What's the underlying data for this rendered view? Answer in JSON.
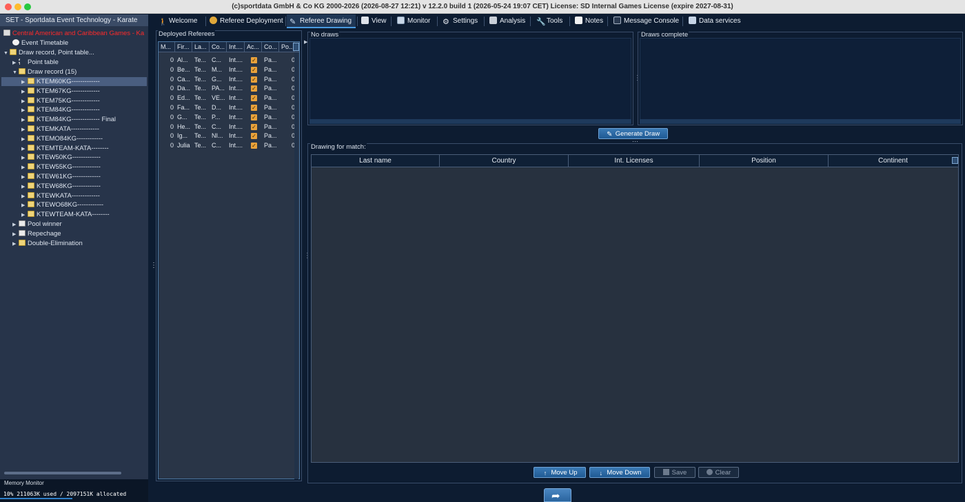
{
  "window": {
    "title": "(c)sportdata GmbH & Co KG 2000-2026 (2026-08-27 12:21)  v 12.2.0 build 1 (2026-05-24 19:07 CET) License: SD Internal Games License (expire 2027-08-31)"
  },
  "left_panel": {
    "header": "SET - Sportdata Event Technology - Karate",
    "tree": {
      "root": "Central American and Caribbean Games - Ka",
      "event_timetable": "Event Timetable",
      "draw_record_point_table": "Draw record, Point table...",
      "point_table": "Point table",
      "draw_record": "Draw record (15)",
      "draws": [
        "KTEM60KG-------------",
        "KTEM67KG-------------",
        "KTEM75KG-------------",
        "KTEM84KG-------------",
        "KTEM84KG------------- Final",
        "KTEMKATA-------------",
        "KTEMO84KG------------",
        "KTEMTEAM-KATA--------",
        "KTEW50KG-------------",
        "KTEW55KG-------------",
        "KTEW61KG-------------",
        "KTEW68KG-------------",
        "KTEWKATA-------------",
        "KTEWO68KG------------",
        "KTEWTEAM-KATA--------"
      ],
      "pool_winner": "Pool winner",
      "repechage": "Repechage",
      "double_elimination": "Double-Elimination"
    }
  },
  "memory": {
    "title": "Memory Monitor",
    "text": "10% 211063K used / 2097151K allocated",
    "percent": 10
  },
  "tabs": [
    "Welcome",
    "Referee Deployment",
    "Referee Drawing",
    "View",
    "Monitor",
    "Settings",
    "Analysis",
    "Tools",
    "Notes",
    "Message Console",
    "Data services"
  ],
  "active_tab": "Referee Drawing",
  "deployed_referees": {
    "legend": "Deployed Referees",
    "columns": [
      "M...",
      "Fir...",
      "La...",
      "Co...",
      "Int....",
      "Ac...",
      "Co...",
      "Po..."
    ],
    "rows": [
      {
        "m": "0",
        "first": "Al...",
        "last": "Te...",
        "country": "C...",
        "int": "Int....",
        "active": true,
        "co": "Pa...",
        "po": "0"
      },
      {
        "m": "0",
        "first": "Be...",
        "last": "Te...",
        "country": "M...",
        "int": "Int....",
        "active": true,
        "co": "Pa...",
        "po": "0"
      },
      {
        "m": "0",
        "first": "Ca...",
        "last": "Te...",
        "country": "G...",
        "int": "Int....",
        "active": true,
        "co": "Pa...",
        "po": "0"
      },
      {
        "m": "0",
        "first": "Da...",
        "last": "Te...",
        "country": "PA...",
        "int": "Int....",
        "active": true,
        "co": "Pa...",
        "po": "0"
      },
      {
        "m": "0",
        "first": "Ed...",
        "last": "Te...",
        "country": "VE...",
        "int": "Int....",
        "active": true,
        "co": "Pa...",
        "po": "0"
      },
      {
        "m": "0",
        "first": "Fa...",
        "last": "Te...",
        "country": "D...",
        "int": "Int....",
        "active": true,
        "co": "Pa...",
        "po": "0"
      },
      {
        "m": "0",
        "first": "G...",
        "last": "Te...",
        "country": "P...",
        "int": "Int....",
        "active": true,
        "co": "Pa...",
        "po": "0"
      },
      {
        "m": "0",
        "first": "He...",
        "last": "Te...",
        "country": "C...",
        "int": "Int....",
        "active": true,
        "co": "Pa...",
        "po": "0"
      },
      {
        "m": "0",
        "first": "Ig...",
        "last": "Te...",
        "country": "NI...",
        "int": "Int....",
        "active": true,
        "co": "Pa...",
        "po": "0"
      },
      {
        "m": "0",
        "first": "Julia",
        "last": "Te...",
        "country": "C...",
        "int": "Int....",
        "active": true,
        "co": "Pa...",
        "po": "0"
      }
    ]
  },
  "no_draws": {
    "legend": "No draws"
  },
  "draws_complete": {
    "legend": "Draws complete"
  },
  "generate_draw": {
    "label": "Generate Draw"
  },
  "drawing_for_match": {
    "legend": "Drawing for match:",
    "columns": [
      "Last name",
      "Country",
      "Int. Licenses",
      "Position",
      "Continent"
    ]
  },
  "buttons": {
    "move_up": "Move Up",
    "move_down": "Move Down",
    "save": "Save",
    "clear": "Clear"
  },
  "colors": {
    "background": "#0d1c31",
    "accent": "#2f7fc8",
    "checkbox": "#e9a23b",
    "root_text": "#ff2a2a"
  }
}
